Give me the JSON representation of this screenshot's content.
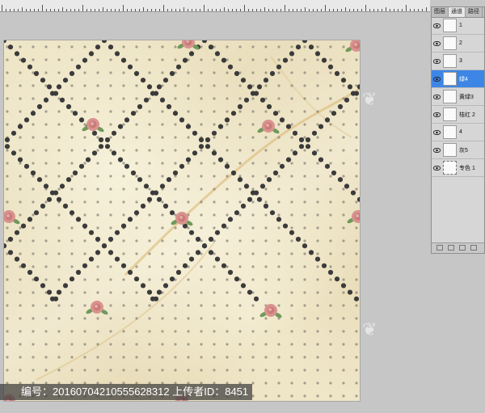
{
  "panel": {
    "tabs": [
      "图层",
      "通道",
      "路径"
    ],
    "channels": [
      {
        "name": "1",
        "visible": true,
        "selected": false
      },
      {
        "name": "2",
        "visible": true,
        "selected": false
      },
      {
        "name": "3",
        "visible": true,
        "selected": false
      },
      {
        "name": "绿4",
        "visible": true,
        "selected": true
      },
      {
        "name": "黄绿3",
        "visible": true,
        "selected": false
      },
      {
        "name": "桔红 2",
        "visible": true,
        "selected": false
      },
      {
        "name": "4",
        "visible": true,
        "selected": false
      },
      {
        "name": "灰5",
        "visible": true,
        "selected": false
      },
      {
        "name": "专色 1",
        "visible": true,
        "selected": false
      }
    ]
  },
  "watermark": {
    "text": "编号：20160704210555628312 上传者ID：8451"
  },
  "colors": {
    "selected_row": "#3d86e6",
    "big_dot": "#3b3b3b",
    "small_dot": "#8a8478",
    "rose": "#d9938f",
    "leaf": "#6f9a5a"
  }
}
